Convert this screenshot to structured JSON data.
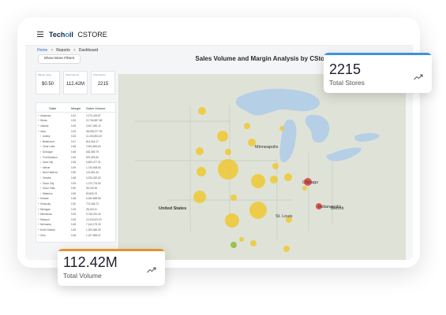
{
  "header": {
    "brand_prefix": "Tech",
    "brand_o": "o",
    "brand_suffix": "il",
    "product": "CSTORE"
  },
  "breadcrumb": {
    "home": "Home",
    "reports": "Reports",
    "dashboard": "Dashboard"
  },
  "filters_button": "Show More Filters",
  "kpi_tiles": [
    {
      "label": "Margin (avg)",
      "value": "$0.50"
    },
    {
      "label": "Total Volume",
      "value": "112.42M"
    },
    {
      "label": "Total Stores",
      "value": "2215"
    }
  ],
  "table": {
    "headers": [
      "State",
      "Margin",
      "Sales Volume"
    ],
    "rows": [
      {
        "name": "Arkansas",
        "margin": "0.42",
        "volume": "2,274,419.87",
        "level": 0
      },
      {
        "name": "Illinois",
        "margin": "0.52",
        "volume": "22,736,897.89",
        "level": 0
      },
      {
        "name": "Indiana",
        "margin": "0.49",
        "volume": "3,167,282.10",
        "level": 0
      },
      {
        "name": "Iowa",
        "margin": "0.49",
        "volume": "36,058,377.93",
        "level": 0
      },
      {
        "name": "Ackley",
        "margin": "0.52",
        "volume": "11,430,854.20",
        "level": 1
      },
      {
        "name": "Bettendorf",
        "margin": "0.47",
        "volume": "813,064.17",
        "level": 1
      },
      {
        "name": "Clear Lake",
        "margin": "0.48",
        "volume": "2,904,564.60",
        "level": 1
      },
      {
        "name": "Dubuque",
        "margin": "0.48",
        "volume": "633,380.79",
        "level": 1
      },
      {
        "name": "Fort Madison",
        "margin": "0.49",
        "volume": "997,690.30",
        "level": 1
      },
      {
        "name": "Iowa City",
        "margin": "0.45",
        "volume": "6,563,477.31",
        "level": 1
      },
      {
        "name": "Melcer",
        "margin": "0.49",
        "volume": "1,740,908.60",
        "level": 1
      },
      {
        "name": "New Hartford",
        "margin": "0.50",
        "volume": "121,651.40",
        "level": 1
      },
      {
        "name": "Omaha",
        "margin": "0.48",
        "volume": "3,226,332.62",
        "level": 1
      },
      {
        "name": "Sioux City",
        "margin": "0.54",
        "volume": "1,070,776.50",
        "level": 1
      },
      {
        "name": "Sioux Falls",
        "margin": "0.50",
        "volume": "99,240.90",
        "level": 1
      },
      {
        "name": "Waterloo",
        "margin": "0.50",
        "volume": "50,830.70",
        "level": 1
      },
      {
        "name": "Kansas",
        "margin": "0.48",
        "volume": "6,260,898.56",
        "level": 0
      },
      {
        "name": "Kentucky",
        "margin": "0.52",
        "volume": "773,466.73",
        "level": 0
      },
      {
        "name": "Michigan",
        "margin": "0.29",
        "volume": "28,153.11",
        "level": 0
      },
      {
        "name": "Minnesota",
        "margin": "0.50",
        "volume": "9,746,291.30",
        "level": 0
      },
      {
        "name": "Missouri",
        "margin": "0.49",
        "volume": "10,115,422.67",
        "level": 0
      },
      {
        "name": "Nebraska",
        "margin": "0.48",
        "volume": "7,144,175.30",
        "level": 0
      },
      {
        "name": "North Dakota",
        "margin": "0.49",
        "volume": "1,200,360.60",
        "level": 0
      },
      {
        "name": "Ohio",
        "margin": "0.48",
        "volume": "1,237,983.67",
        "level": 0
      }
    ]
  },
  "map": {
    "title": "Sales Volume and Margin Analysis by CStore",
    "labels": {
      "country": "United States",
      "city_chicago": "Chicago",
      "city_indianapolis": "Indianapolis",
      "city_detroit": "Detroit",
      "city_st_louis": "St. Louis",
      "city_minneapolis": "Minneapolis"
    },
    "colors": {
      "land": "#dfe3d7",
      "water": "#b5cfe6",
      "high_margin": "#f2c41c",
      "low_margin": "#dd3a3a",
      "mid_margin": "#8fba3a"
    }
  },
  "cards": {
    "stores": {
      "value": "2215",
      "label": "Total Stores",
      "accent": "#3d93d8",
      "icon": "trend-up-icon"
    },
    "volume": {
      "value": "112.42M",
      "label": "Total Volume",
      "accent": "#e6922e",
      "icon": "trend-up-icon"
    }
  }
}
